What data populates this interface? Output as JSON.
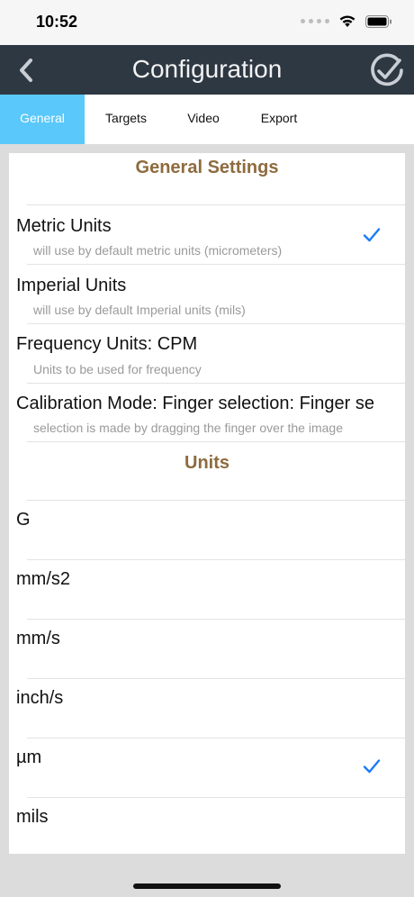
{
  "status": {
    "time": "10:52"
  },
  "nav": {
    "title": "Configuration",
    "back_icon": "chevron-left-icon",
    "done_icon": "check-circle-icon"
  },
  "tabs": [
    {
      "label": "General",
      "active": true
    },
    {
      "label": "Targets",
      "active": false
    },
    {
      "label": "Video",
      "active": false
    },
    {
      "label": "Export",
      "active": false
    }
  ],
  "general": {
    "header": "General Settings",
    "items": [
      {
        "title": "Metric Units",
        "subtitle": "will use by default metric units (micrometers)",
        "checked": true
      },
      {
        "title": "Imperial Units",
        "subtitle": "will use by default Imperial units (mils)",
        "checked": false
      },
      {
        "title": "Frequency Units: CPM",
        "subtitle": "Units to be used for frequency",
        "checked": false
      },
      {
        "title": "Calibration Mode: Finger selection: Finger se",
        "subtitle": "selection is made by dragging the finger over the image",
        "checked": false
      }
    ]
  },
  "units": {
    "header": "Units",
    "items": [
      {
        "title": "G",
        "checked": false
      },
      {
        "title": "mm/s2",
        "checked": false
      },
      {
        "title": "mm/s",
        "checked": false
      },
      {
        "title": "inch/s",
        "checked": false
      },
      {
        "title": "µm",
        "checked": true
      },
      {
        "title": "mils",
        "checked": false
      }
    ]
  },
  "colors": {
    "navbar": "#2e3843",
    "tab_active": "#5ac8fa",
    "section_header": "#8e6b3e",
    "check": "#1a7cf5"
  }
}
